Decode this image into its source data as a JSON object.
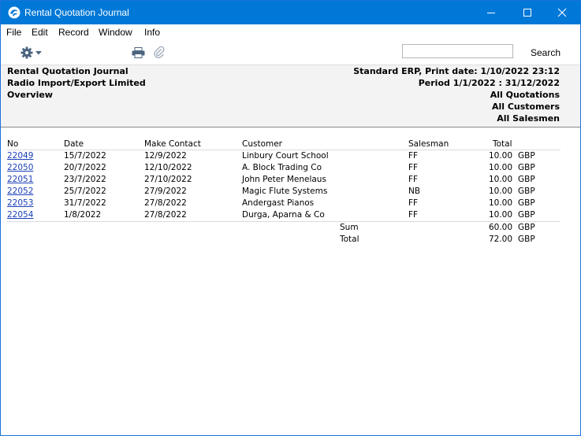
{
  "window": {
    "title": "Rental Quotation Journal"
  },
  "menu": {
    "file": "File",
    "edit": "Edit",
    "record": "Record",
    "window": "Window",
    "info": "Info"
  },
  "toolbar": {
    "search_label": "Search",
    "search_value": ""
  },
  "report": {
    "title": "Rental Quotation Journal",
    "company": "Radio Import/Export Limited",
    "mode": "Overview",
    "print_info": "Standard ERP, Print date: 1/10/2022 23:12",
    "period": "Period  1/1/2022 : 31/12/2022",
    "filter_quotations": "All Quotations",
    "filter_customers": "All Customers",
    "filter_salesmen": "All Salesmen"
  },
  "columns": {
    "no": "No",
    "date": "Date",
    "make_contact": "Make Contact",
    "customer": "Customer",
    "salesman": "Salesman",
    "total": "Total"
  },
  "rows": [
    {
      "no": "22049",
      "date": "15/7/2022",
      "make_contact": "12/9/2022",
      "customer": "Linbury Court School",
      "salesman": "FF",
      "total": "10.00",
      "currency": "GBP"
    },
    {
      "no": "22050",
      "date": "20/7/2022",
      "make_contact": "12/10/2022",
      "customer": "A. Block Trading Co",
      "salesman": "FF",
      "total": "10.00",
      "currency": "GBP"
    },
    {
      "no": "22051",
      "date": "23/7/2022",
      "make_contact": "27/10/2022",
      "customer": "John Peter Menelaus",
      "salesman": "FF",
      "total": "10.00",
      "currency": "GBP"
    },
    {
      "no": "22052",
      "date": "25/7/2022",
      "make_contact": "27/9/2022",
      "customer": "Magic Flute Systems",
      "salesman": "NB",
      "total": "10.00",
      "currency": "GBP"
    },
    {
      "no": "22053",
      "date": "31/7/2022",
      "make_contact": "27/8/2022",
      "customer": "Andergast Pianos",
      "salesman": "FF",
      "total": "10.00",
      "currency": "GBP"
    },
    {
      "no": "22054",
      "date": "1/8/2022",
      "make_contact": "27/8/2022",
      "customer": "Durga, Aparna & Co",
      "salesman": "FF",
      "total": "10.00",
      "currency": "GBP"
    }
  ],
  "summary": {
    "sum_label": "Sum",
    "sum_value": "60.00",
    "sum_currency": "GBP",
    "total_label": "Total",
    "total_value": "72.00",
    "total_currency": "GBP"
  },
  "icons": {
    "app": "app-logo-icon",
    "gear": "gear-icon",
    "printer": "printer-icon",
    "attachment": "paperclip-icon",
    "minimize": "minimize-icon",
    "maximize": "maximize-icon",
    "close": "close-icon"
  },
  "colors": {
    "titlebar": "#0078d7",
    "link": "#1a3fb8",
    "header_bg": "#f3f3f3"
  }
}
